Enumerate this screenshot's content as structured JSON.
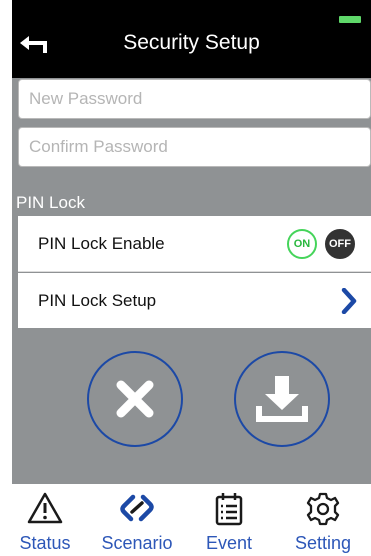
{
  "header": {
    "title": "Security Setup",
    "back_icon": "back-arrow-icon"
  },
  "form": {
    "new_password_placeholder": "New Password",
    "confirm_password_placeholder": "Confirm Password"
  },
  "pin_lock": {
    "section_label": "PIN Lock",
    "enable_label": "PIN Lock Enable",
    "toggle_on": "ON",
    "toggle_off": "OFF",
    "setup_label": "PIN Lock Setup"
  },
  "actions": {
    "cancel_icon": "close-icon",
    "save_icon": "download-icon"
  },
  "tabbar": {
    "items": [
      {
        "label": "Status",
        "icon": "warning-icon"
      },
      {
        "label": "Scenario",
        "icon": "scenario-icon"
      },
      {
        "label": "Event",
        "icon": "event-list-icon"
      },
      {
        "label": "Setting",
        "icon": "gear-icon"
      }
    ]
  },
  "colors": {
    "background": "#8f9294",
    "header": "#000000",
    "accent_blue": "#2d57b8",
    "toggle_on_green": "#45d45a",
    "battery_green": "#5fd86a"
  }
}
